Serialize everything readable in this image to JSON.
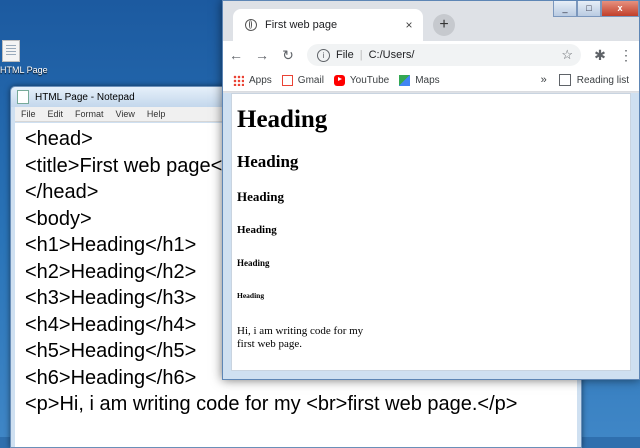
{
  "desktop": {
    "icons": [
      {
        "label": "HTML Page"
      }
    ]
  },
  "notepad": {
    "title": "HTML Page - Notepad",
    "menu": [
      "File",
      "Edit",
      "Format",
      "View",
      "Help"
    ],
    "lines": [
      "<head>",
      "<title>First web page</title>",
      "</head>",
      "<body>",
      "<h1>Heading</h1>",
      "<h2>Heading</h2>",
      "<h3>Heading</h3>",
      "<h4>Heading</h4>",
      "<h5>Heading</h5>",
      "<h6>Heading</h6>",
      "<p>Hi, i am writing code for my <br>first web page.</p>"
    ]
  },
  "browser": {
    "tab_title": "First web page",
    "tab_close": "×",
    "new_tab": "+",
    "window_buttons": {
      "minimize": "_",
      "maximize": "□",
      "close": "x"
    },
    "address": {
      "scheme_label": "File",
      "path": "C:/Users/"
    },
    "bookmarks": [
      "Apps",
      "Gmail",
      "YouTube",
      "Maps"
    ],
    "more_bookmarks": "»",
    "reading_list": "Reading list",
    "page": {
      "h1": "Heading",
      "h2": "Heading",
      "h3": "Heading",
      "h4": "Heading",
      "h5": "Heading",
      "h6": "Heading",
      "p_line1": "Hi, i am writing code for my",
      "p_line2": "first web page."
    }
  }
}
